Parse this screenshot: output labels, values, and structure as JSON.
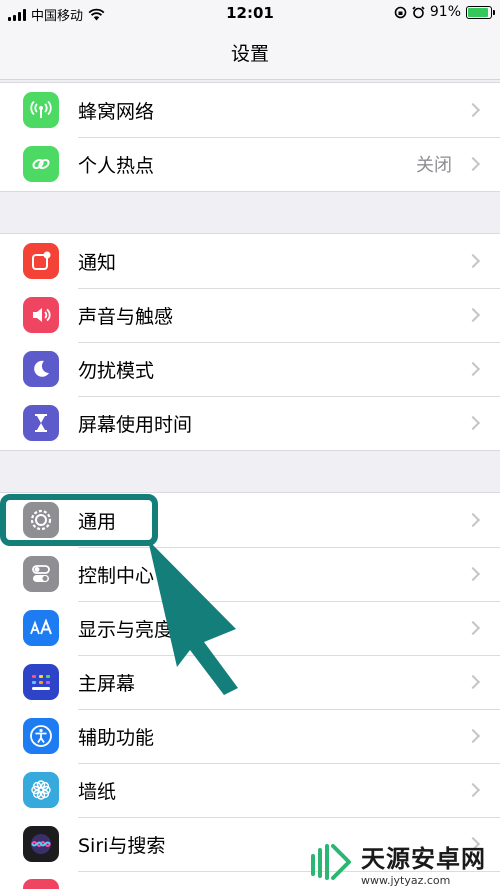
{
  "status_bar": {
    "carrier": "中国移动",
    "time": "12:01",
    "battery_percent": "91%",
    "battery_level": 0.91
  },
  "header": {
    "title": "设置"
  },
  "groups": [
    {
      "items": [
        {
          "label": "蜂窝网络",
          "icon": "antenna-icon",
          "color": "#4cd964"
        },
        {
          "label": "个人热点",
          "value": "关闭",
          "icon": "link-icon",
          "color": "#4cd964"
        }
      ]
    },
    {
      "items": [
        {
          "label": "通知",
          "icon": "notification-icon",
          "color": "#f44336"
        },
        {
          "label": "声音与触感",
          "icon": "speaker-icon",
          "color": "#ef4561"
        },
        {
          "label": "勿扰模式",
          "icon": "moon-icon",
          "color": "#5d5acb"
        },
        {
          "label": "屏幕使用时间",
          "icon": "hourglass-icon",
          "color": "#5d5acb"
        }
      ]
    },
    {
      "items": [
        {
          "label": "通用",
          "icon": "gear-icon",
          "color": "#8e8e93"
        },
        {
          "label": "控制中心",
          "icon": "toggle-icon",
          "color": "#8e8e93"
        },
        {
          "label": "显示与亮度",
          "icon": "text-size-icon",
          "color": "#1e7cf2"
        },
        {
          "label": "主屏幕",
          "icon": "home-grid-icon",
          "color": "#2d43c8"
        },
        {
          "label": "辅助功能",
          "icon": "accessibility-icon",
          "color": "#1e7cf2"
        },
        {
          "label": "墙纸",
          "icon": "flower-icon",
          "color": "#36aadc"
        },
        {
          "label": "Siri与搜索",
          "icon": "siri-icon",
          "color": "#222"
        }
      ]
    }
  ],
  "watermark": {
    "name": "天源安卓网",
    "url": "www.jytyaz.com"
  },
  "colors": {
    "highlight": "#147f7a",
    "chevron": "#c4c4c9",
    "background": "#efeff4"
  }
}
